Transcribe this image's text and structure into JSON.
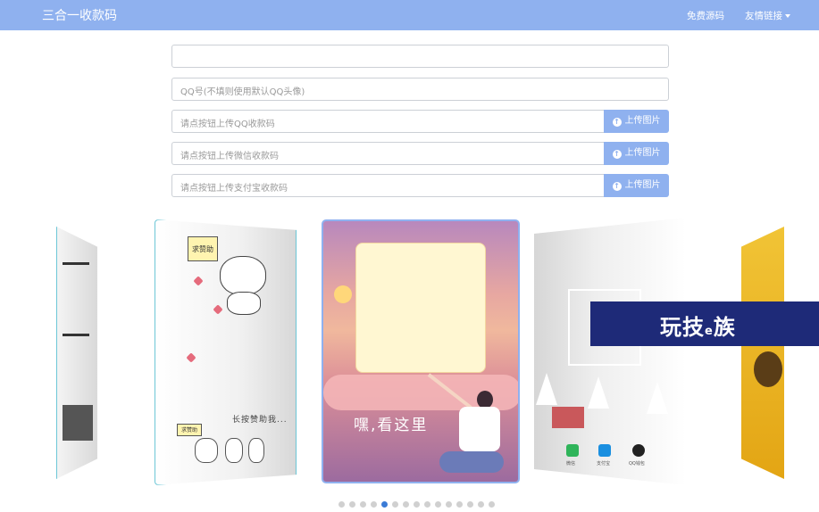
{
  "navbar": {
    "brand": "三合一收款码",
    "free_source": "免费源码",
    "friend_links": "友情链接"
  },
  "form": {
    "title_field": {
      "value": "",
      "placeholder": ""
    },
    "qq_field": {
      "value": "",
      "placeholder": "QQ号(不填则使用默认QQ头像)"
    },
    "uploads": [
      {
        "placeholder": "请点按钮上传QQ收款码",
        "button": "上传图片"
      },
      {
        "placeholder": "请点按钮上传微信收款码",
        "button": "上传图片"
      },
      {
        "placeholder": "请点按钮上传支付宝收款码",
        "button": "上传图片"
      }
    ]
  },
  "carousel": {
    "center_caption": "嘿,看这里",
    "left_sign": "求赞助",
    "left_caption": "长按赞助我...",
    "left_mini_sign": "求赞助",
    "pay_labels": [
      "微信",
      "支付宝",
      "QQ钱包"
    ],
    "slide_count": 15,
    "active_slide": 4
  },
  "watermark": {
    "text_a": "玩技",
    "text_e": "e",
    "text_b": "族"
  },
  "colors": {
    "primary": "#8fb1ef",
    "active_dot": "#3b7bd6",
    "watermark_bg": "#1e2a78"
  }
}
